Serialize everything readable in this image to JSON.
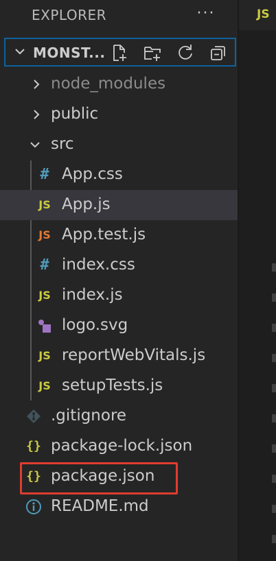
{
  "explorer": {
    "title": "EXPLORER",
    "more_actions": "···"
  },
  "workspace": {
    "folder_name": "MONST...",
    "actions": [
      "new-file-icon",
      "new-folder-icon",
      "refresh-icon",
      "collapse-all-icon"
    ]
  },
  "tree": {
    "node_modules": "node_modules",
    "public": "public",
    "src": "src",
    "src_files": [
      {
        "name": "App.css",
        "icon": "#"
      },
      {
        "name": "App.js",
        "icon": "JS"
      },
      {
        "name": "App.test.js",
        "icon": "JS"
      },
      {
        "name": "index.css",
        "icon": "#"
      },
      {
        "name": "index.js",
        "icon": "JS"
      },
      {
        "name": "logo.svg",
        "icon": "svg-icon"
      },
      {
        "name": "reportWebVitals.js",
        "icon": "JS"
      },
      {
        "name": "setupTests.js",
        "icon": "JS"
      }
    ],
    "root_files": [
      {
        "name": ".gitignore",
        "icon": "git-icon"
      },
      {
        "name": "package-lock.json",
        "icon": "{}"
      },
      {
        "name": "package.json",
        "icon": "{}"
      },
      {
        "name": "README.md",
        "icon": "info-icon"
      }
    ],
    "selected": "App.js",
    "highlighted": "package.json"
  },
  "editor": {
    "tab_icon": "JS"
  },
  "colors": {
    "sidebar_bg": "#252526",
    "selection_bg": "#37373d",
    "focus_border": "#0e639c",
    "highlight_border": "#e03c2e",
    "js_yellow": "#cbcb41",
    "test_orange": "#e37933",
    "css_blue": "#519aba",
    "svg_purple": "#a074c4"
  }
}
